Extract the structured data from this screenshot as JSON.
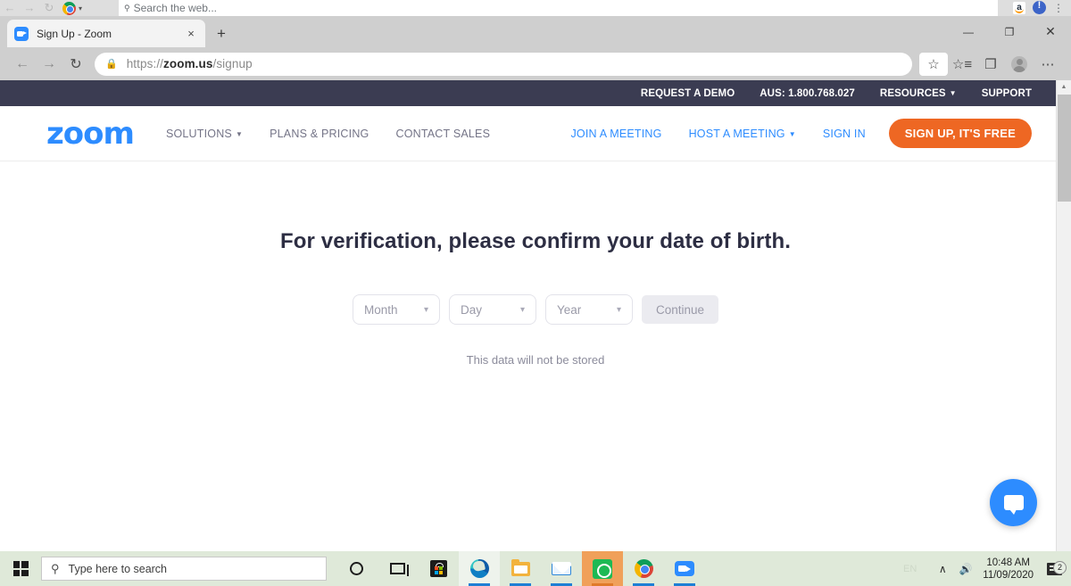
{
  "background_window": {
    "search_placeholder": "Search the web...",
    "icons": [
      "back-arrow-icon",
      "forward-arrow-icon",
      "reload-icon",
      "chrome-icon",
      "amazon-extension-icon",
      "duckduckgo-extension-icon",
      "chrome-menu-icon"
    ]
  },
  "browser": {
    "tab": {
      "title": "Sign Up - Zoom",
      "close_label": "×"
    },
    "new_tab_label": "+",
    "window_controls": {
      "minimize": "—",
      "restore": "❐",
      "close": "✕"
    },
    "url": {
      "prefix": "https://",
      "domain": "zoom.us",
      "path": "/signup"
    },
    "toolbar_icons": [
      "back-arrow-icon",
      "forward-arrow-icon",
      "reload-icon",
      "lock-icon",
      "favorite-star-icon",
      "favorites-list-icon",
      "collections-icon",
      "profile-avatar-icon",
      "settings-more-icon"
    ]
  },
  "page": {
    "topbar": {
      "links": [
        {
          "label": "REQUEST A DEMO",
          "has_caret": false
        },
        {
          "label": "AUS: 1.800.768.027",
          "has_caret": false
        },
        {
          "label": "RESOURCES",
          "has_caret": true
        },
        {
          "label": "SUPPORT",
          "has_caret": false
        }
      ]
    },
    "nav": {
      "logo": "zoom",
      "left_links": [
        {
          "label": "SOLUTIONS",
          "has_caret": true
        },
        {
          "label": "PLANS & PRICING",
          "has_caret": false
        },
        {
          "label": "CONTACT SALES",
          "has_caret": false
        }
      ],
      "right_links": [
        {
          "label": "JOIN A MEETING",
          "has_caret": false
        },
        {
          "label": "HOST A MEETING",
          "has_caret": true
        },
        {
          "label": "SIGN IN",
          "has_caret": false
        }
      ],
      "cta_label": "SIGN UP, IT'S FREE",
      "cta_color": "#ee6723",
      "accent_color": "#2d8cff"
    },
    "main": {
      "headline": "For verification, please confirm your date of birth.",
      "selects": [
        {
          "value": "Month"
        },
        {
          "value": "Day"
        },
        {
          "value": "Year"
        }
      ],
      "continue_label": "Continue",
      "note": "This data will not be stored"
    },
    "chat_widget": {
      "icon": "chat-bubble-icon",
      "color": "#2d8cff"
    }
  },
  "taskbar": {
    "search_placeholder": "Type here to search",
    "items": [
      {
        "name": "cortana-icon"
      },
      {
        "name": "task-view-icon"
      },
      {
        "name": "microsoft-store-icon"
      },
      {
        "name": "microsoft-edge-icon"
      },
      {
        "name": "file-explorer-icon"
      },
      {
        "name": "mail-icon"
      },
      {
        "name": "spotify-icon"
      },
      {
        "name": "google-chrome-icon"
      },
      {
        "name": "zoom-icon"
      }
    ],
    "tray": {
      "language": "EN",
      "show_hidden_icons": "∧",
      "volume_icon": "volume-icon",
      "time": "10:48 AM",
      "date": "11/09/2020",
      "notification_count": "2"
    }
  }
}
